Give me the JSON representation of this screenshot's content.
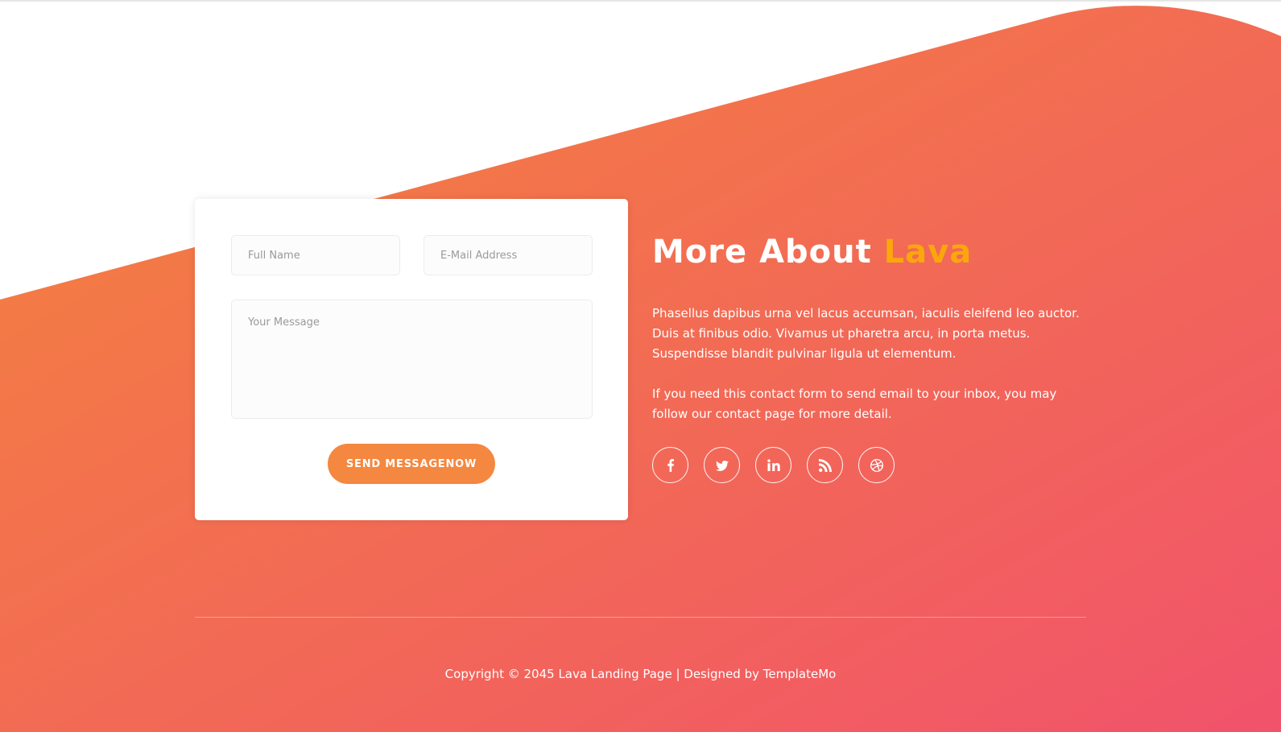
{
  "colors": {
    "gradient_start": "#f4843c",
    "gradient_end": "#f1536b",
    "accent": "#fba70b",
    "button": "#f48840"
  },
  "form": {
    "name_placeholder": "Full Name",
    "email_placeholder": "E-Mail Address",
    "message_placeholder": "Your Message",
    "send_label": "SEND MESSAGENOW"
  },
  "about": {
    "title_main": "More About ",
    "title_accent": "Lava",
    "paragraph_1": "Phasellus dapibus urna vel lacus accumsan, iaculis eleifend leo auctor. Duis at finibus odio. Vivamus ut pharetra arcu, in porta metus. Suspendisse blandit pulvinar ligula ut elementum.",
    "paragraph_2": "If you need this contact form to send email to your inbox, you may follow our contact page for more detail."
  },
  "social": [
    "facebook-icon",
    "twitter-icon",
    "linkedin-icon",
    "rss-icon",
    "dribbble-icon"
  ],
  "footer": {
    "copyright": "Copyright © 2045 Lava Landing Page | Designed by TemplateMo"
  }
}
